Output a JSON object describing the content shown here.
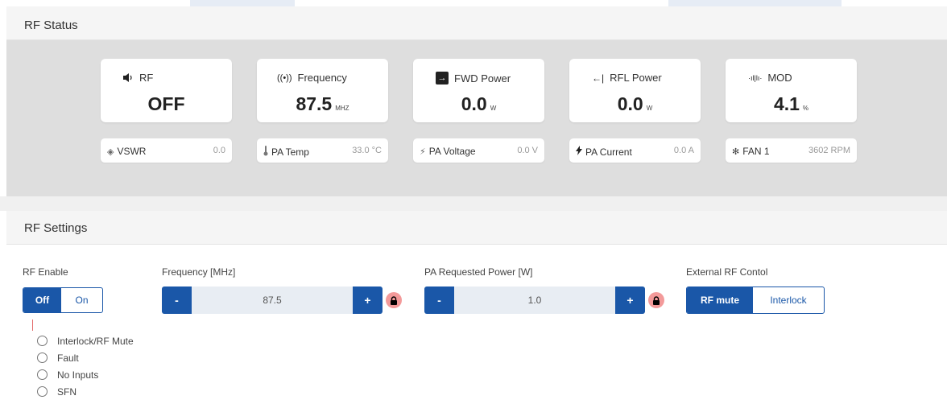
{
  "rf_status": {
    "heading": "RF Status",
    "cards": [
      {
        "title": "RF",
        "icon": "speaker-icon",
        "glyph": "🔈",
        "value": "OFF",
        "unit": ""
      },
      {
        "title": "Frequency",
        "icon": "broadcast-icon",
        "glyph": "((•))",
        "value": "87.5",
        "unit": "MHZ"
      },
      {
        "title": "FWD Power",
        "icon": "arrow-right-box-icon",
        "glyph": "→",
        "value": "0.0",
        "unit": "W"
      },
      {
        "title": "RFL Power",
        "icon": "arrow-left-bar-icon",
        "glyph": "←|",
        "value": "0.0",
        "unit": "W"
      },
      {
        "title": "MOD",
        "icon": "waveform-icon",
        "glyph": "·ıl|lı·",
        "value": "4.1",
        "unit": "%"
      }
    ],
    "pills": [
      {
        "label": "VSWR",
        "icon": "vswr-icon",
        "glyph": "◈",
        "value": "0.0"
      },
      {
        "label": "PA Temp",
        "icon": "thermometer-icon",
        "glyph": "🌡",
        "value": "33.0 °C"
      },
      {
        "label": "PA Voltage",
        "icon": "voltage-icon",
        "glyph": "⚡",
        "value": "0.0 V"
      },
      {
        "label": "PA Current",
        "icon": "bolt-icon",
        "glyph": "ϟ",
        "value": "0.0 A"
      },
      {
        "label": "FAN 1",
        "icon": "fan-icon",
        "glyph": "✻",
        "value": "3602 RPM"
      }
    ]
  },
  "rf_settings": {
    "heading": "RF Settings",
    "rf_enable": {
      "label": "RF Enable",
      "options": [
        "Off",
        "On"
      ],
      "selected": "Off"
    },
    "frequency": {
      "label": "Frequency [MHz]",
      "value": "87.5",
      "minus": "-",
      "plus": "+"
    },
    "pa_power": {
      "label": "PA Requested Power [W]",
      "value": "1.0",
      "minus": "-",
      "plus": "+"
    },
    "external_rf": {
      "label": "External RF Contol",
      "options": [
        "RF mute",
        "Interlock"
      ],
      "selected": "RF mute"
    },
    "radio_options": [
      "Interlock/RF Mute",
      "Fault",
      "No Inputs",
      "SFN"
    ]
  },
  "colors": {
    "primary": "#1a57a8",
    "lock_bg": "#f39a9a",
    "panel_bg": "#dedede"
  }
}
